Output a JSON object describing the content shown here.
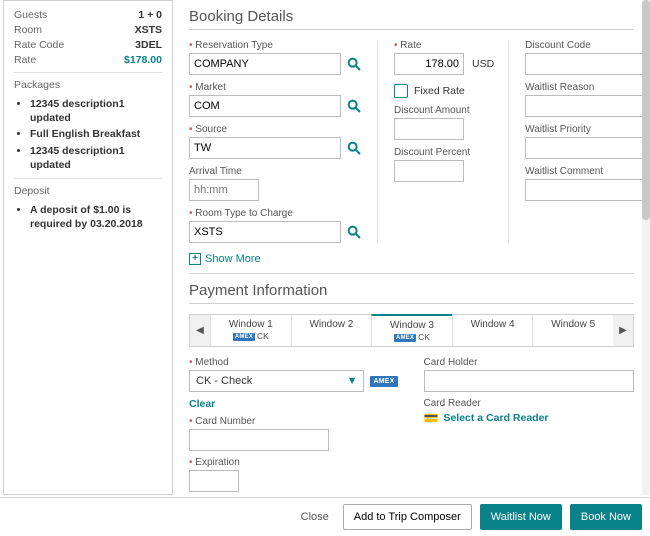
{
  "sidebar": {
    "guests": {
      "label": "Guests",
      "value": "1 + 0"
    },
    "room": {
      "label": "Room",
      "value": "XSTS"
    },
    "rate_code": {
      "label": "Rate Code",
      "value": "3DEL"
    },
    "rate": {
      "label": "Rate",
      "value": "$178.00"
    },
    "packages_title": "Packages",
    "packages": [
      "12345 description1 updated",
      "Full English Breakfast",
      "12345 description1 updated"
    ],
    "deposit_title": "Deposit",
    "deposit_items": [
      "A deposit of $1.00 is required by 03.20.2018"
    ]
  },
  "booking": {
    "title": "Booking Details",
    "reservation_type": {
      "label": "Reservation Type",
      "value": "COMPANY"
    },
    "market": {
      "label": "Market",
      "value": "COM"
    },
    "source": {
      "label": "Source",
      "value": "TW"
    },
    "arrival_time": {
      "label": "Arrival Time",
      "placeholder": "hh:mm",
      "value": ""
    },
    "room_type_charge": {
      "label": "Room Type to Charge",
      "value": "XSTS"
    },
    "rate": {
      "label": "Rate",
      "value": "178.00",
      "unit": "USD"
    },
    "fixed_rate_label": "Fixed Rate",
    "discount_amount": {
      "label": "Discount Amount",
      "value": ""
    },
    "discount_percent": {
      "label": "Discount Percent",
      "value": ""
    },
    "discount_code": {
      "label": "Discount Code",
      "value": ""
    },
    "waitlist_reason": {
      "label": "Waitlist Reason",
      "value": ""
    },
    "waitlist_priority": {
      "label": "Waitlist Priority",
      "value": ""
    },
    "waitlist_comment": {
      "label": "Waitlist Comment",
      "value": ""
    },
    "show_more": "Show More"
  },
  "payment": {
    "title": "Payment Information",
    "tabs": [
      {
        "name": "Window 1",
        "sub_prefix": "AMEX",
        "sub": "CK"
      },
      {
        "name": "Window 2",
        "sub_prefix": "",
        "sub": ""
      },
      {
        "name": "Window 3",
        "sub_prefix": "AMEX",
        "sub": "CK"
      },
      {
        "name": "Window 4",
        "sub_prefix": "",
        "sub": ""
      },
      {
        "name": "Window 5",
        "sub_prefix": "",
        "sub": ""
      }
    ],
    "active_tab_index": 2,
    "method": {
      "label": "Method",
      "value": "CK - Check"
    },
    "clear": "Clear",
    "card_number": {
      "label": "Card Number",
      "value": ""
    },
    "expiration": {
      "label": "Expiration",
      "value": ""
    },
    "card_holder": {
      "label": "Card Holder",
      "value": ""
    },
    "card_reader_label": "Card Reader",
    "select_reader": "Select a Card Reader"
  },
  "footer": {
    "close": "Close",
    "add_trip": "Add to Trip Composer",
    "waitlist": "Waitlist Now",
    "book": "Book Now"
  }
}
